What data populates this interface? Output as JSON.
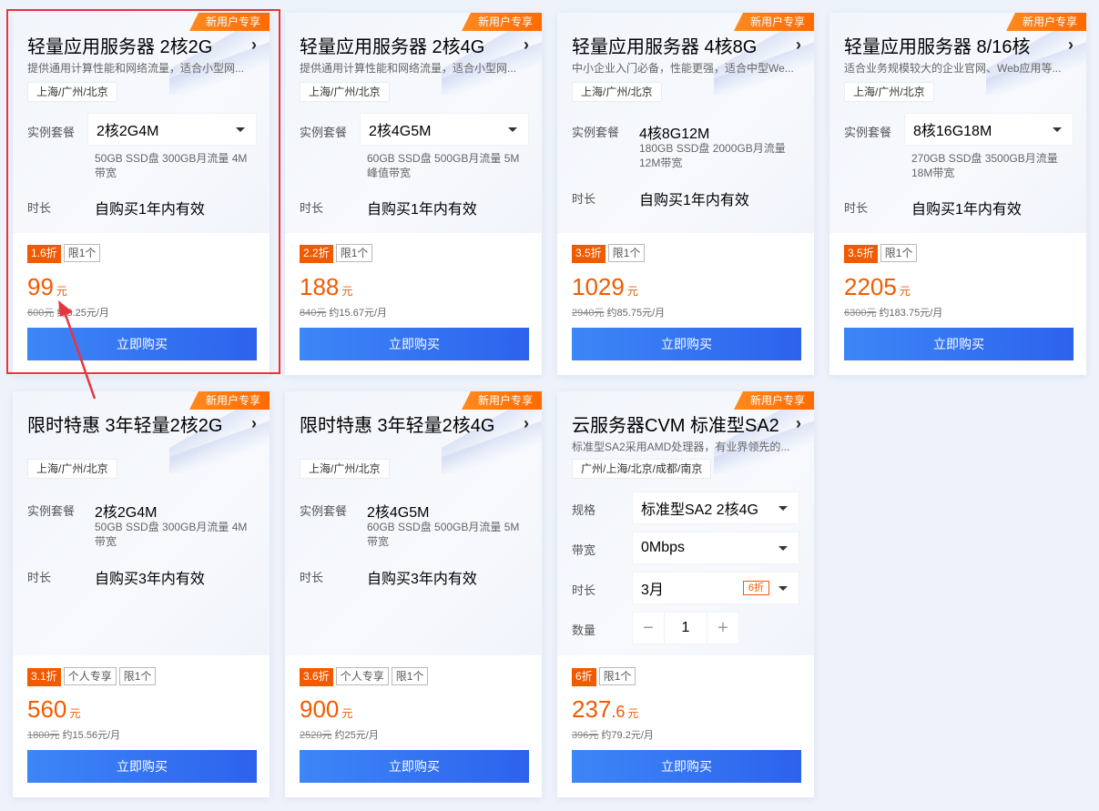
{
  "cards": [
    {
      "badge": "新用户专享",
      "title": "轻量应用服务器 2核2G",
      "desc": "提供通用计算性能和网络流量，适合小型网...",
      "region": "上海/广州/北京",
      "pkg_label": "实例套餐",
      "pkg_value": "2核2G4M",
      "pkg_detail": "50GB SSD盘 300GB月流量 4M带宽",
      "duration_label": "时长",
      "duration_value": "自购买1年内有效",
      "discount": "1.6折",
      "limit": "限1个",
      "price": "99",
      "unit": "元",
      "original": "600元",
      "monthly": "约8.25元/月",
      "buy": "立即购买"
    },
    {
      "badge": "新用户专享",
      "title": "轻量应用服务器 2核4G",
      "desc": "提供通用计算性能和网络流量，适合小型网...",
      "region": "上海/广州/北京",
      "pkg_label": "实例套餐",
      "pkg_value": "2核4G5M",
      "pkg_detail": "60GB SSD盘 500GB月流量 5M峰值带宽",
      "duration_label": "时长",
      "duration_value": "自购买1年内有效",
      "discount": "2.2折",
      "limit": "限1个",
      "price": "188",
      "unit": "元",
      "original": "840元",
      "monthly": "约15.67元/月",
      "buy": "立即购买"
    },
    {
      "badge": "新用户专享",
      "title": "轻量应用服务器 4核8G",
      "desc": "中小企业入门必备，性能更强，适合中型We...",
      "region": "上海/广州/北京",
      "pkg_label": "实例套餐",
      "pkg_value": "4核8G12M",
      "pkg_detail": "180GB SSD盘 2000GB月流量 12M带宽",
      "duration_label": "时长",
      "duration_value": "自购买1年内有效",
      "discount": "3.5折",
      "limit": "限1个",
      "price": "1029",
      "unit": "元",
      "original": "2940元",
      "monthly": "约85.75元/月",
      "buy": "立即购买"
    },
    {
      "badge": "新用户专享",
      "title": "轻量应用服务器 8/16核",
      "desc": "适合业务规模较大的企业官网、Web应用等...",
      "region": "上海/广州/北京",
      "pkg_label": "实例套餐",
      "pkg_value": "8核16G18M",
      "pkg_detail": "270GB SSD盘 3500GB月流量 18M带宽",
      "duration_label": "时长",
      "duration_value": "自购买1年内有效",
      "discount": "3.5折",
      "limit": "限1个",
      "price": "2205",
      "unit": "元",
      "original": "6300元",
      "monthly": "约183.75元/月",
      "buy": "立即购买"
    },
    {
      "badge": "新用户专享",
      "title": "限时特惠 3年轻量2核2G",
      "region": "上海/广州/北京",
      "pkg_label": "实例套餐",
      "pkg_value": "2核2G4M",
      "pkg_detail": "50GB SSD盘 300GB月流量 4M带宽",
      "duration_label": "时长",
      "duration_value": "自购买3年内有效",
      "discount": "3.1折",
      "personal": "个人专享",
      "limit": "限1个",
      "price": "560",
      "unit": "元",
      "original": "1800元",
      "monthly": "约15.56元/月",
      "buy": "立即购买"
    },
    {
      "badge": "新用户专享",
      "title": "限时特惠 3年轻量2核4G",
      "region": "上海/广州/北京",
      "pkg_label": "实例套餐",
      "pkg_value": "2核4G5M",
      "pkg_detail": "60GB SSD盘 500GB月流量 5M带宽",
      "duration_label": "时长",
      "duration_value": "自购买3年内有效",
      "discount": "3.6折",
      "personal": "个人专享",
      "limit": "限1个",
      "price": "900",
      "unit": "元",
      "original": "2520元",
      "monthly": "约25元/月",
      "buy": "立即购买"
    },
    {
      "badge": "新用户专享",
      "title": "云服务器CVM 标准型SA2",
      "desc": "标准型SA2采用AMD处理器，有业界领先的...",
      "region": "广州/上海/北京/成都/南京",
      "spec_label": "规格",
      "spec_value": "标准型SA2 2核4G",
      "bw_label": "带宽",
      "bw_value": "0Mbps",
      "duration_label": "时长",
      "duration_value": "3月",
      "duration_tag": "6折",
      "qty_label": "数量",
      "qty_minus": "−",
      "qty_value": "1",
      "qty_plus": "+",
      "discount": "6折",
      "limit": "限1个",
      "price_int": "237",
      "price_dec": ".6",
      "unit": "元",
      "original": "396元",
      "monthly": "约79.2元/月",
      "buy": "立即购买"
    }
  ],
  "highlight_color": "#e8343c",
  "accent_orange": "#f25a00",
  "button_blue": "#2d62ec"
}
